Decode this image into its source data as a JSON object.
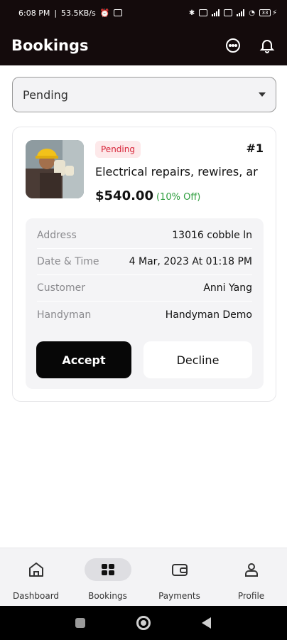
{
  "status_bar": {
    "time": "6:08 PM",
    "net_speed": "53.5KB/s",
    "alarm_icon": "alarm-icon",
    "battery": "33"
  },
  "header": {
    "title": "Bookings",
    "chat_icon": "chat-bubble-icon",
    "bell_icon": "bell-icon",
    "background": "#140b0c"
  },
  "filter": {
    "selected": "Pending"
  },
  "booking": {
    "status": "Pending",
    "number": "#1",
    "service": "Electrical repairs, rewires, ar",
    "price": "$540.00",
    "discount": "(10% Off)",
    "details": [
      {
        "label": "Address",
        "value": "13016 cobble ln"
      },
      {
        "label": "Date & Time",
        "value": "4 Mar, 2023 At 01:18 PM"
      },
      {
        "label": "Customer",
        "value": "Anni Yang"
      },
      {
        "label": "Handyman",
        "value": "Handyman Demo"
      }
    ],
    "accept_label": "Accept",
    "decline_label": "Decline"
  },
  "bottom_nav": {
    "items": [
      {
        "label": "Dashboard",
        "icon": "home-icon"
      },
      {
        "label": "Bookings",
        "icon": "bookings-icon",
        "active": true
      },
      {
        "label": "Payments",
        "icon": "wallet-icon"
      },
      {
        "label": "Profile",
        "icon": "profile-icon"
      }
    ]
  },
  "colors": {
    "accent_dark": "#070707",
    "pending_red": "#d8263a",
    "discount_green": "#2e9e3e"
  }
}
